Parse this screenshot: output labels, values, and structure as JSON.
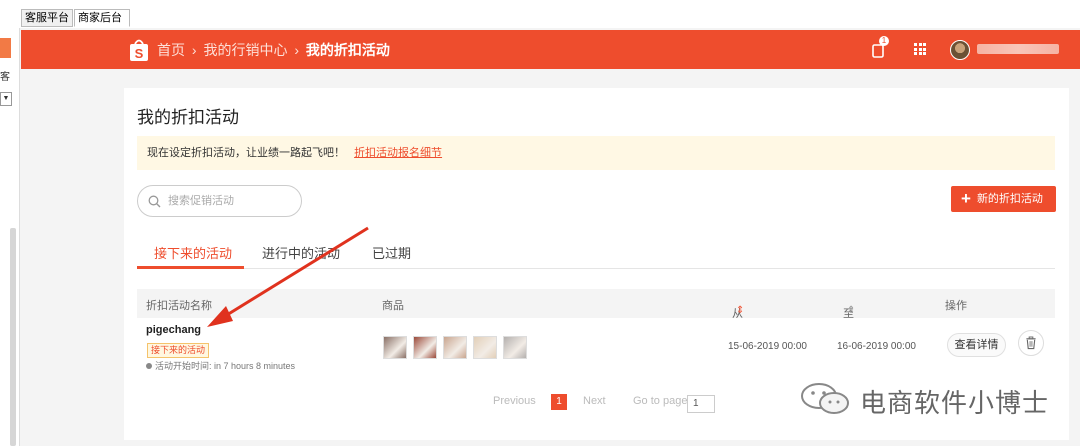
{
  "browser_tabs": [
    "客服平台",
    "商家后台"
  ],
  "left_panel": {
    "char": "客"
  },
  "header": {
    "crumbs": [
      "首页",
      "我的行销中心",
      "我的折扣活动"
    ],
    "separator": "›",
    "notification_count": "1"
  },
  "page": {
    "title": "我的折扣活动",
    "notice_text": "现在设定折扣活动，让业绩一路起飞吧！",
    "notice_link": "折扣活动报名细节",
    "search_placeholder": "搜索促销活动",
    "new_button_label": "新的折扣活动"
  },
  "tabs": [
    {
      "label": "接下来的活动",
      "active": true
    },
    {
      "label": "进行中的活动",
      "active": false
    },
    {
      "label": "已过期",
      "active": false
    }
  ],
  "table": {
    "headers": {
      "name": "折扣活动名称",
      "products": "商品",
      "from": "从",
      "to": "至",
      "actions": "操作"
    },
    "rows": [
      {
        "name": "pigechang",
        "status": "接下来的活动",
        "start_info": "活动开始时间: in 7 hours 8 minutes",
        "from": "15-06-2019 00:00",
        "to": "16-06-2019 00:00",
        "detail_label": "查看详情",
        "thumb_colors": [
          "#8a7066",
          "#9b4a3a",
          "#c9a58f",
          "#e2cfb8",
          "#b4b0ae"
        ]
      }
    ]
  },
  "pagination": {
    "previous": "Previous",
    "current": "1",
    "next": "Next",
    "goto": "Go to page",
    "page_value": "1"
  },
  "watermark": {
    "text": "电商软件小博士"
  },
  "colors": {
    "brand": "#ee4d2d",
    "notice_bg": "#fff8e4",
    "arrow": "#e0321e"
  }
}
